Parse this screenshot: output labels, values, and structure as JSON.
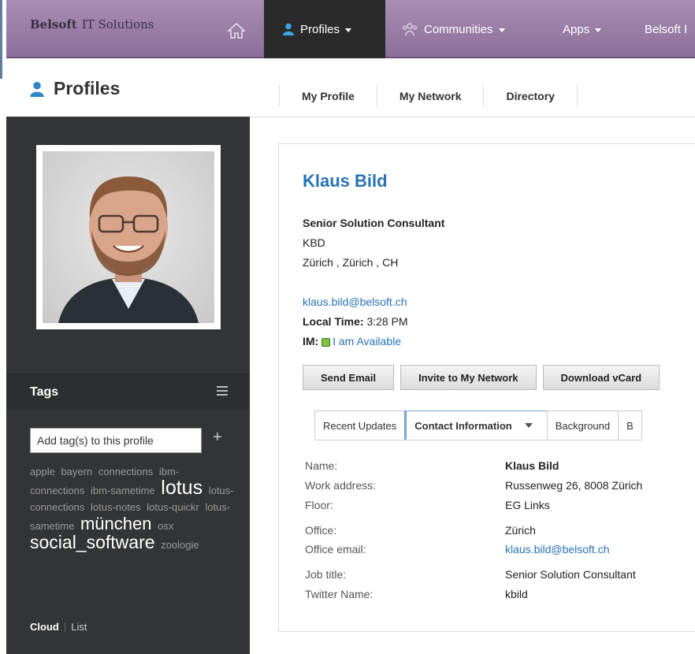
{
  "nav": {
    "brand_part1": "Belsoft",
    "brand_part2": "IT Solutions",
    "profiles": "Profiles",
    "communities": "Communities",
    "apps": "Apps",
    "belsoft": "Belsoft I"
  },
  "subheader": {
    "title": "Profiles",
    "links": [
      "My Profile",
      "My Network",
      "Directory"
    ]
  },
  "sidebar": {
    "tags_label": "Tags",
    "tag_input_placeholder": "Add tag(s) to this profile",
    "tags": [
      {
        "text": "apple",
        "size": "sm"
      },
      {
        "text": "bayern",
        "size": "sm"
      },
      {
        "text": "connections",
        "size": "sm"
      },
      {
        "text": "ibm-connections",
        "size": "sm"
      },
      {
        "text": "ibm-sametime",
        "size": "sm"
      },
      {
        "text": "lotus",
        "size": "lg"
      },
      {
        "text": "lotus-connections",
        "size": "sm"
      },
      {
        "text": "lotus-notes",
        "size": "sm"
      },
      {
        "text": "lotus-quickr",
        "size": "sm"
      },
      {
        "text": "lotus-sametime",
        "size": "sm"
      },
      {
        "text": "münchen",
        "size": "md"
      },
      {
        "text": "osx",
        "size": "sm"
      },
      {
        "text": "social_software",
        "size": "xl"
      },
      {
        "text": "zoologie",
        "size": "sm"
      }
    ],
    "view_cloud": "Cloud",
    "view_list": "List"
  },
  "profile": {
    "name": "Klaus Bild",
    "job_title": "Senior Solution Consultant",
    "dept": "KBD",
    "location": "Zürich , Zürich , CH",
    "email": "klaus.bild@belsoft.ch",
    "local_time_label": "Local Time:",
    "local_time": "3:28 PM",
    "im_label": "IM:",
    "im_status": "I am Available"
  },
  "buttons": [
    "Send Email",
    "Invite to My Network",
    "Download vCard"
  ],
  "tabs": [
    "Recent Updates",
    "Contact Information",
    "Background",
    "B"
  ],
  "contact": [
    {
      "k": "Name:",
      "v": "Klaus Bild",
      "bold": true
    },
    {
      "k": "Work address:",
      "v": "Russenweg 26, 8008 Zürich"
    },
    {
      "k": "Floor:",
      "v": "EG Links"
    },
    {
      "k": "Office:",
      "v": "Zürich"
    },
    {
      "k": "Office email:",
      "v": "klaus.bild@belsoft.ch",
      "link": true
    },
    {
      "k": "Job title:",
      "v": "Senior Solution Consultant"
    },
    {
      "k": "Twitter Name:",
      "v": "kbild"
    }
  ]
}
